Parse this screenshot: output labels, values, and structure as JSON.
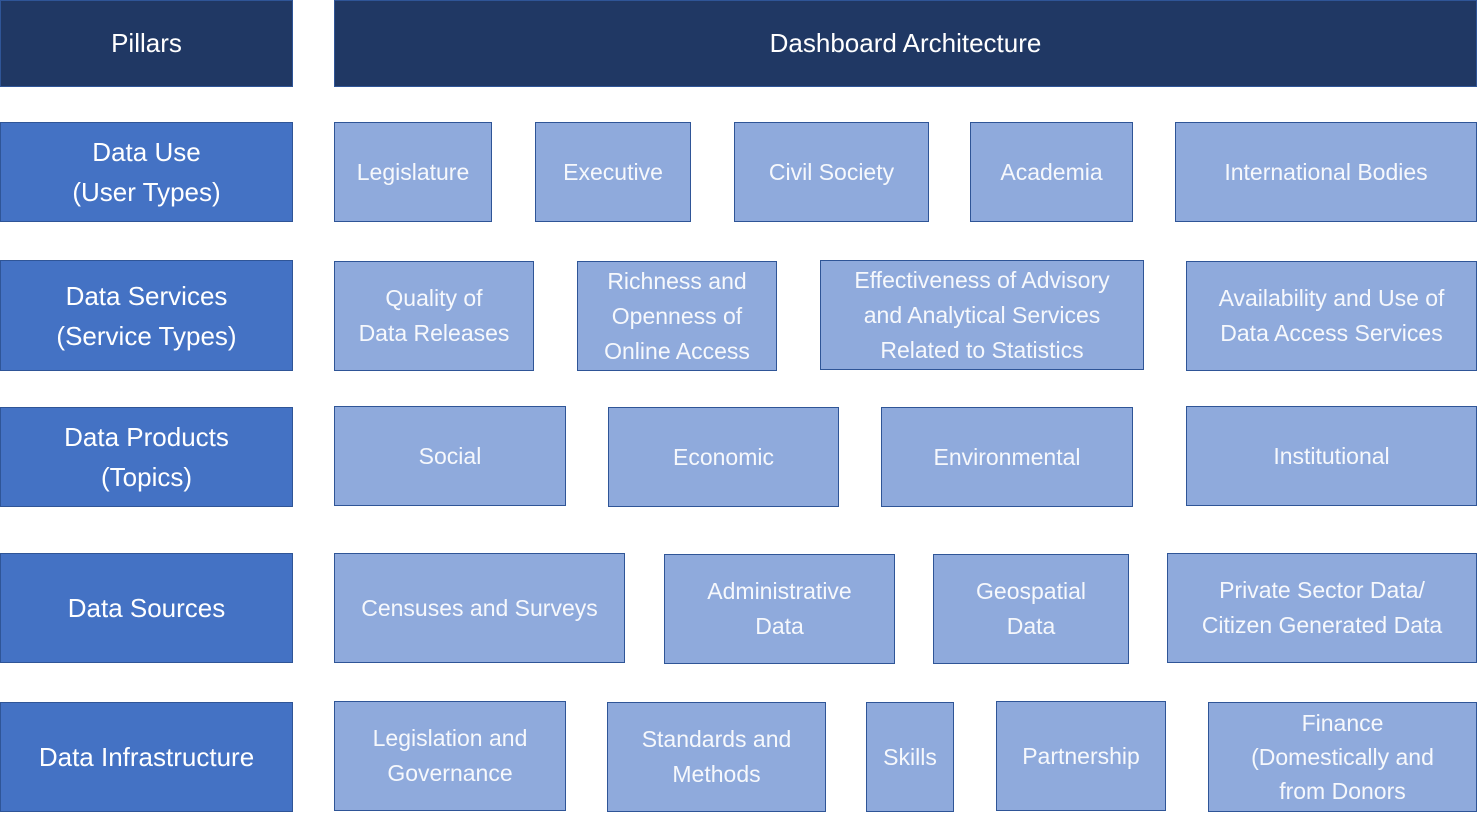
{
  "header": {
    "pillars_label": "Pillars",
    "architecture_label": "Dashboard Architecture"
  },
  "rows": [
    {
      "pillar": "Data Use\n(User Types)",
      "items": [
        "Legislature",
        "Executive",
        "Civil Society",
        "Academia",
        "International  Bodies"
      ]
    },
    {
      "pillar": "Data Services\n(Service Types)",
      "items": [
        "Quality of\nData Releases",
        "Richness and\nOpenness  of\nOnline Access",
        "Effectiveness  of Advisory\nand Analytical Services\nRelated to Statistics",
        "Availability and Use of\nData Access  Services"
      ]
    },
    {
      "pillar": "Data Products\n(Topics)",
      "items": [
        "Social",
        "Economic",
        "Environmental",
        "Institutional"
      ]
    },
    {
      "pillar": "Data Sources",
      "items": [
        "Censuses  and Surveys",
        "Administrative\nData",
        "Geospatial\nData",
        "Private Sector Data/\nCitizen Generated Data"
      ]
    },
    {
      "pillar": "Data Infrastructure",
      "items": [
        "Legislation and\nGovernance",
        "Standards and\nMethods",
        "Skills",
        "Partnership",
        "Finance\n(Domestically and\nfrom Donors"
      ]
    }
  ]
}
